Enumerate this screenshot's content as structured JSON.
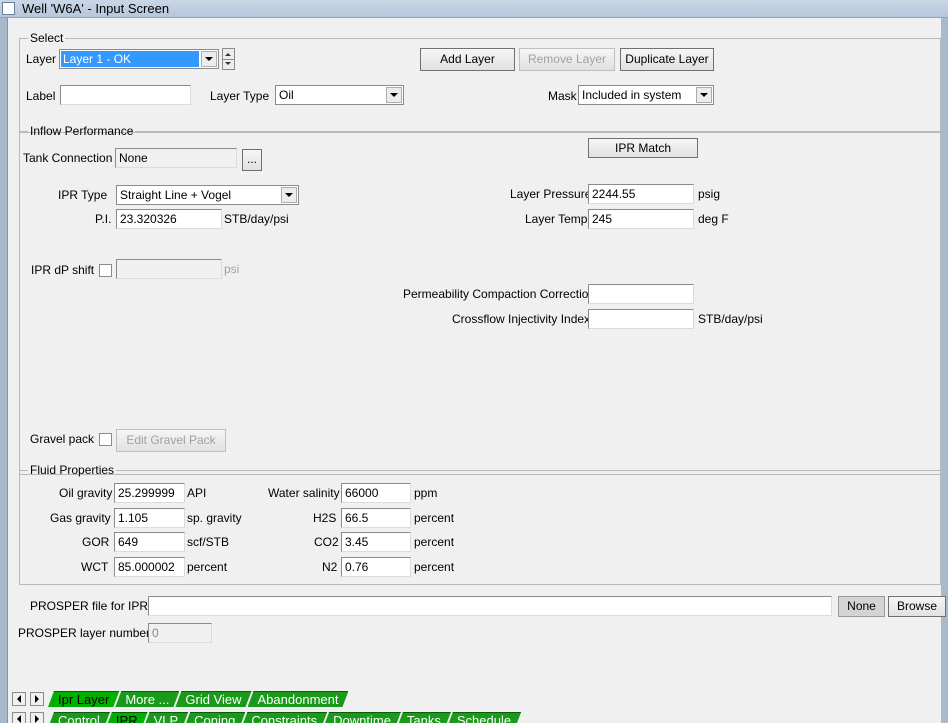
{
  "window": {
    "title": "Well 'W6A' - Input Screen"
  },
  "select_group": {
    "legend": "Select",
    "layer_label": "Layer",
    "layer_value": "Layer 1 - OK",
    "add_layer": "Add Layer",
    "remove_layer": "Remove Layer",
    "duplicate_layer": "Duplicate Layer",
    "label_label": "Label",
    "label_value": "",
    "layer_type_label": "Layer Type",
    "layer_type_value": "Oil",
    "mask_label": "Mask",
    "mask_value": "Included in system"
  },
  "inflow_group": {
    "legend": "Inflow Performance",
    "tank_connection_label": "Tank Connection",
    "tank_connection_value": "None",
    "tank_browse": "...",
    "ipr_match": "IPR Match",
    "ipr_type_label": "IPR Type",
    "ipr_type_value": "Straight Line + Vogel",
    "pi_label": "P.I.",
    "pi_value": "23.320326",
    "pi_unit": "STB/day/psi",
    "layer_pressure_label": "Layer Pressure",
    "layer_pressure_value": "2244.55",
    "layer_pressure_unit": "psig",
    "layer_temp_label": "Layer Temp",
    "layer_temp_value": "245",
    "layer_temp_unit": "deg F",
    "ipr_dp_shift_label": "IPR dP shift",
    "ipr_dp_shift_value": "",
    "ipr_dp_shift_unit": "psi",
    "perm_comp_label": "Permeability Compaction Correction",
    "perm_comp_value": "",
    "crossflow_label": "Crossflow Injectivity Index",
    "crossflow_value": "",
    "crossflow_unit": "STB/day/psi",
    "gravel_pack_label": "Gravel pack",
    "edit_gravel_pack": "Edit Gravel Pack"
  },
  "fluid_group": {
    "legend": "Fluid Properties",
    "oil_gravity_label": "Oil gravity",
    "oil_gravity_value": "25.299999",
    "oil_gravity_unit": "API",
    "gas_gravity_label": "Gas gravity",
    "gas_gravity_value": "1.105",
    "gas_gravity_unit": "sp. gravity",
    "gor_label": "GOR",
    "gor_value": "649",
    "gor_unit": "scf/STB",
    "wct_label": "WCT",
    "wct_value": "85.000002",
    "wct_unit": "percent",
    "water_salinity_label": "Water salinity",
    "water_salinity_value": "66000",
    "water_salinity_unit": "ppm",
    "h2s_label": "H2S",
    "h2s_value": "66.5",
    "h2s_unit": "percent",
    "co2_label": "CO2",
    "co2_value": "3.45",
    "co2_unit": "percent",
    "n2_label": "N2",
    "n2_value": "0.76",
    "n2_unit": "percent"
  },
  "prosper": {
    "file_label": "PROSPER file for IPR",
    "file_value": "",
    "none_button": "None",
    "browse_button": "Browse",
    "layer_number_label": "PROSPER layer number",
    "layer_number_value": "0"
  },
  "subtabs": [
    "Ipr Layer",
    "More ...",
    "Grid View",
    "Abandonment"
  ],
  "maintabs": [
    "Control",
    "IPR",
    "VLP",
    "Coning",
    "Constraints",
    "Downtime",
    "Tanks",
    "Schedule"
  ],
  "colors": {
    "tab_green": "#1a9a1a",
    "selection_blue": "#3399ff"
  }
}
